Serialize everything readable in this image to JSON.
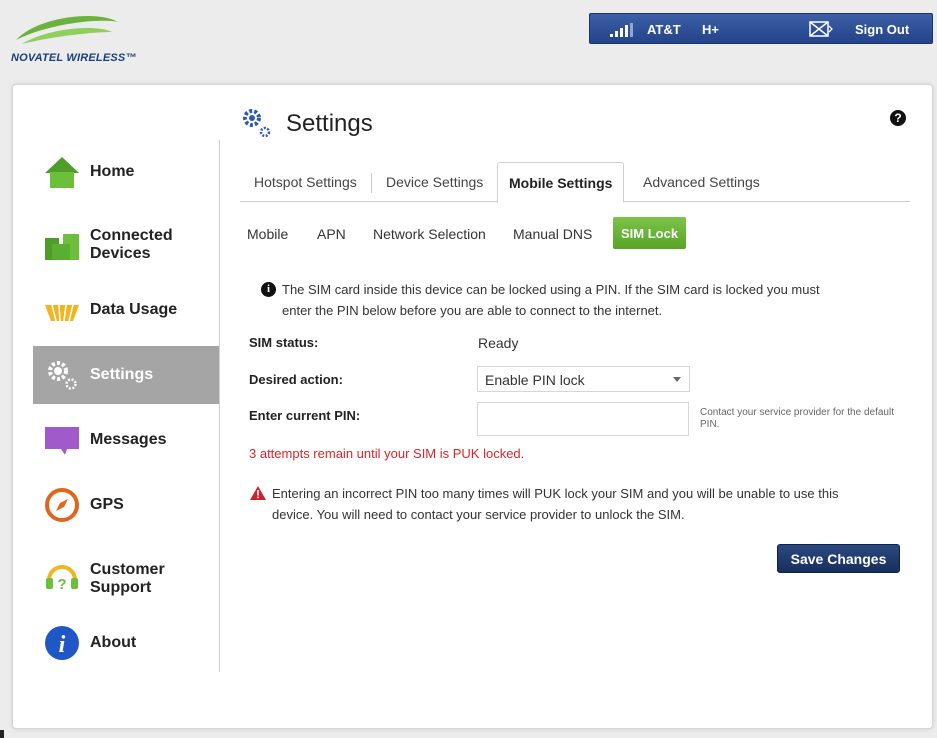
{
  "brand": {
    "logo_text": "NOVATEL WIRELESS™"
  },
  "topbar": {
    "carrier": "AT&T",
    "network_type": "H+",
    "signout_label": "Sign Out",
    "signal_icon": "signal-bars-icon",
    "sms_icon": "envelope-icon"
  },
  "sidebar": {
    "items": [
      {
        "label": "Home",
        "icon": "home-icon"
      },
      {
        "label_line1": "Connected",
        "label_line2": "Devices",
        "icon": "connected-devices-icon"
      },
      {
        "label": "Data Usage",
        "icon": "data-usage-icon"
      },
      {
        "label": "Settings",
        "icon": "gear-icon",
        "active": true
      },
      {
        "label": "Messages",
        "icon": "message-bubble-icon"
      },
      {
        "label": "GPS",
        "icon": "compass-icon"
      },
      {
        "label_line1": "Customer",
        "label_line2": "Support",
        "icon": "support-icon"
      },
      {
        "label": "About",
        "icon": "info-icon"
      }
    ]
  },
  "page": {
    "title": "Settings",
    "help_glyph": "?"
  },
  "tabs": [
    {
      "label": "Hotspot Settings"
    },
    {
      "label": "Device Settings"
    },
    {
      "label": "Mobile Settings",
      "active": true
    },
    {
      "label": "Advanced Settings"
    }
  ],
  "subtabs": [
    {
      "label": "Mobile"
    },
    {
      "label": "APN"
    },
    {
      "label": "Network Selection"
    },
    {
      "label": "Manual DNS"
    },
    {
      "label": "SIM Lock",
      "active": true
    }
  ],
  "sim_lock": {
    "info_glyph": "i",
    "info_line1": "The SIM card inside this device can be locked using a PIN. If the SIM card is locked you must",
    "info_line2": "enter the PIN below before you are able to connect to the internet.",
    "status_label": "SIM status:",
    "status_value": "Ready",
    "action_label": "Desired action:",
    "action_value": "Enable PIN lock",
    "pin_label": "Enter current PIN:",
    "pin_value": "",
    "pin_hint": "Contact your service provider for the default PIN.",
    "attempts_text": "3 attempts remain until your SIM is PUK locked.",
    "warning_line1": "Entering an incorrect PIN too many times will PUK lock your SIM and you will be unable to use this",
    "warning_line2": "device. You will need to contact your service provider to unlock the SIM.",
    "save_label": "Save Changes"
  },
  "colors": {
    "accent_green": "#57a527",
    "topbar_blue": "#2d4f98",
    "save_navy": "#1c3566",
    "alert_red": "#d8262a",
    "active_nav_gray": "#a5a5a5"
  }
}
